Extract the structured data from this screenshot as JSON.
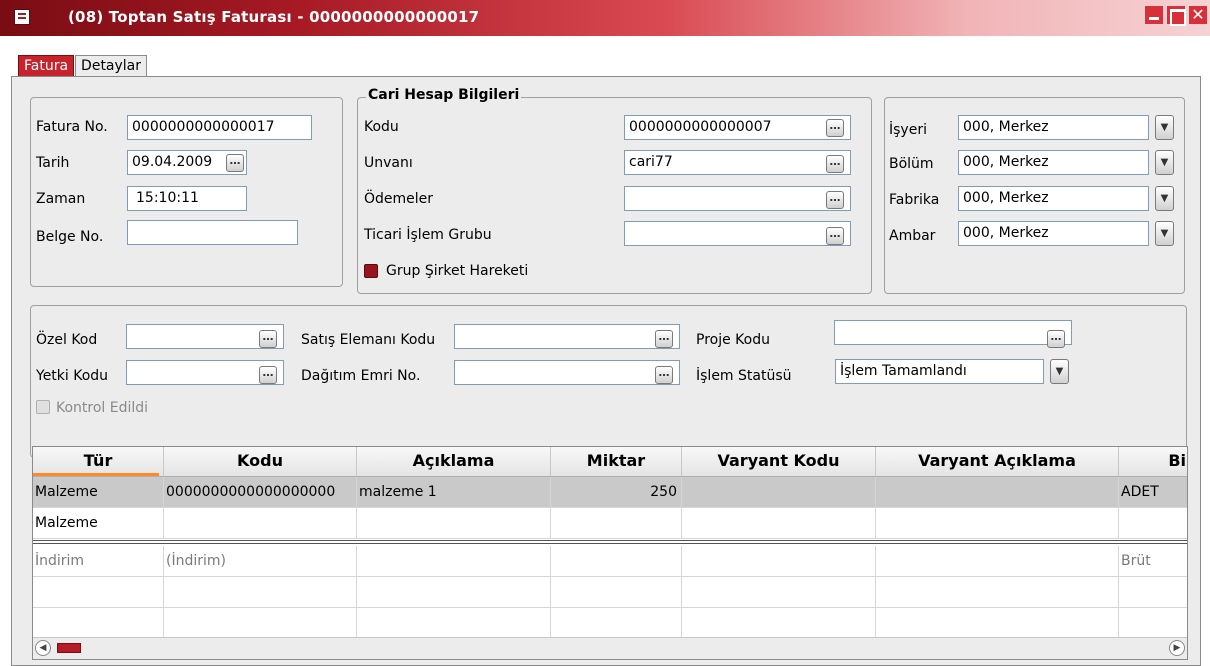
{
  "window": {
    "title": "(08) Toptan Satış Faturası - 0000000000000017",
    "icon": "document-icon"
  },
  "tabs": [
    {
      "label": "Fatura",
      "active": true
    },
    {
      "label": "Detaylar",
      "active": false
    }
  ],
  "invoice": {
    "fatura_no_label": "Fatura No.",
    "fatura_no": "0000000000000017",
    "tarih_label": "Tarih",
    "tarih": "09.04.2009",
    "zaman_label": "Zaman",
    "zaman": "15:10:11",
    "belge_no_label": "Belge No.",
    "belge_no": ""
  },
  "cari": {
    "title": "Cari Hesap Bilgileri",
    "kodu_label": "Kodu",
    "kodu": "0000000000000007",
    "unvani_label": "Unvanı",
    "unvani": "cari77",
    "odemeler_label": "Ödemeler",
    "odemeler": "",
    "ticari_label": "Ticari İşlem Grubu",
    "ticari": "",
    "grup_label": "Grup Şirket Hareketi",
    "checkbox_color": "#9a1420"
  },
  "org": {
    "isyeri_label": "İşyeri",
    "isyeri": "000, Merkez",
    "bolum_label": "Bölüm",
    "bolum": "000, Merkez",
    "fabrika_label": "Fabrika",
    "fabrika": "000, Merkez",
    "ambar_label": "Ambar",
    "ambar": "000, Merkez"
  },
  "codes": {
    "ozel_kod_label": "Özel Kod",
    "ozel_kod": "",
    "yetki_kodu_label": "Yetki Kodu",
    "yetki_kodu": "",
    "satis_label": "Satış Elemanı Kodu",
    "satis": "",
    "dagitim_label": "Dağıtım Emri No.",
    "dagitim": "",
    "proje_label": "Proje Kodu",
    "proje": "",
    "islem_label": "İşlem Statüsü",
    "islem": "İşlem Tamamlandı",
    "kontrol_label": "Kontrol Edildi"
  },
  "grid": {
    "columns": [
      "Tür",
      "Kodu",
      "Açıklama",
      "Miktar",
      "Varyant Kodu",
      "Varyant Açıklama",
      "Bi"
    ],
    "rows": [
      [
        "Malzeme",
        "0000000000000000000",
        "malzeme 1",
        "250",
        "",
        "",
        "ADET"
      ],
      [
        "Malzeme",
        "",
        "",
        "",
        "",
        "",
        ""
      ]
    ],
    "discount_row": [
      "İndirim",
      "(İndirim)",
      "",
      "",
      "",
      "",
      "Brüt"
    ]
  },
  "colors": {
    "accent": "#c7232d",
    "active_column": "#ff8a2a"
  }
}
